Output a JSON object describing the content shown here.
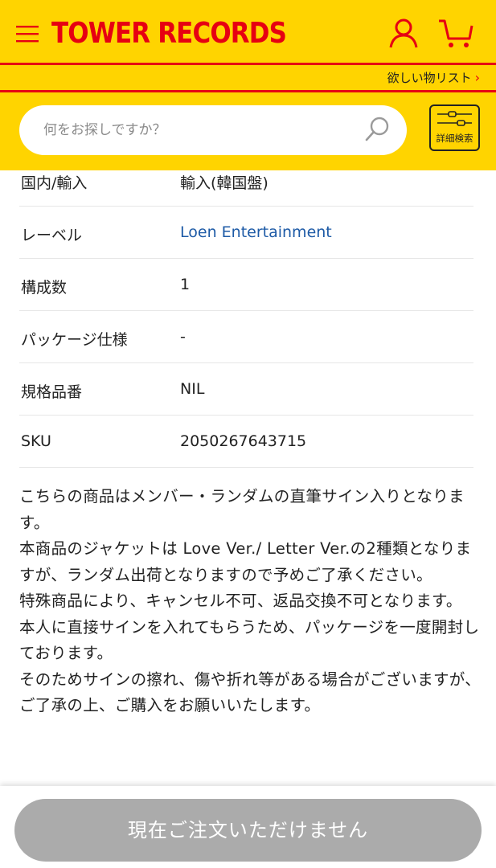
{
  "header": {
    "logo_text": "TOWER RECORDS",
    "wishlist_label": "欲しい物リスト",
    "wishlist_chevron": "›",
    "brand_color": "#ffd400",
    "accent_color": "#e60012"
  },
  "search": {
    "placeholder": "何をお探しですか？",
    "advanced_label": "詳細検索"
  },
  "specs": [
    {
      "label": "国内/輸入",
      "value": "輸入(韓国盤)",
      "is_link": false
    },
    {
      "label": "レーベル",
      "value": "Loen Entertainment",
      "is_link": true
    },
    {
      "label": "構成数",
      "value": "1",
      "is_link": false
    },
    {
      "label": "パッケージ仕様",
      "value": "-",
      "is_link": false
    },
    {
      "label": "規格品番",
      "value": "NIL",
      "is_link": false
    },
    {
      "label": "SKU",
      "value": "2050267643715",
      "is_link": false
    }
  ],
  "description": [
    "こちらの商品はメンバー・ランダムの直筆サイン入りとなります。",
    "本商品のジャケットは Love Ver./ Letter Ver.の2種類となりますが、ランダム出荷となりますので予めご了承ください。",
    "特殊商品により、キャンセル不可、返品交換不可となります。",
    "本人に直接サインを入れてもらうため、パッケージを一度開封しております。",
    "そのためサインの擦れ、傷や折れ等がある場合がございますが、ご了承の上、ご購入をお願いいたします。"
  ],
  "footer": {
    "order_button_label": "現在ご注文いただけません",
    "order_button_color": "#ababab"
  },
  "icons": {
    "menu": "hamburger-menu-icon",
    "user": "user-icon",
    "cart": "cart-icon",
    "search": "search-icon",
    "advanced": "sliders-icon"
  }
}
